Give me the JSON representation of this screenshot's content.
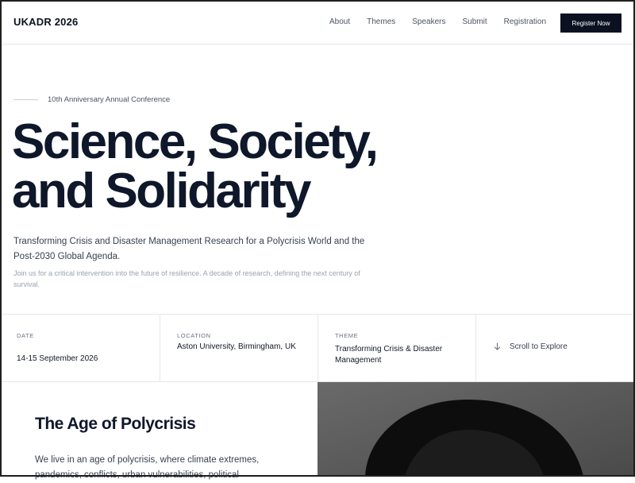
{
  "header": {
    "logo": "UKADR 2026",
    "nav": [
      "About",
      "Themes",
      "Speakers",
      "Submit",
      "Registration"
    ],
    "cta": "Register Now"
  },
  "hero": {
    "eyebrow": "10th Anniversary Annual Conference",
    "title_line1": "Science, Society,",
    "title_line2": "and Solidarity",
    "subtitle": "Transforming Crisis and Disaster Management Research for a Polycrisis World and the Post-2030 Global Agenda.",
    "intro": "Join us for a critical intervention into the future of resilience. A decade of research, defining the next century of survival."
  },
  "info": {
    "date_label": "DATE",
    "date_value": "14-15 September 2026",
    "location_label": "LOCATION",
    "location_value": "Aston University, Birmingham, UK",
    "theme_label": "THEME",
    "theme_value": "Transforming Crisis & Disaster Management",
    "scroll_label": "Scroll to Explore",
    "scroll_icon": "arrow-down-icon"
  },
  "section": {
    "title": "The Age of Polycrisis",
    "text": "We live in an age of polycrisis, where climate extremes, pandemics, conflicts, urban vulnerabilities, political"
  },
  "colors": {
    "cta_bg": "#0b1120",
    "heading": "#0f172a",
    "photo_bg": "#555555"
  }
}
